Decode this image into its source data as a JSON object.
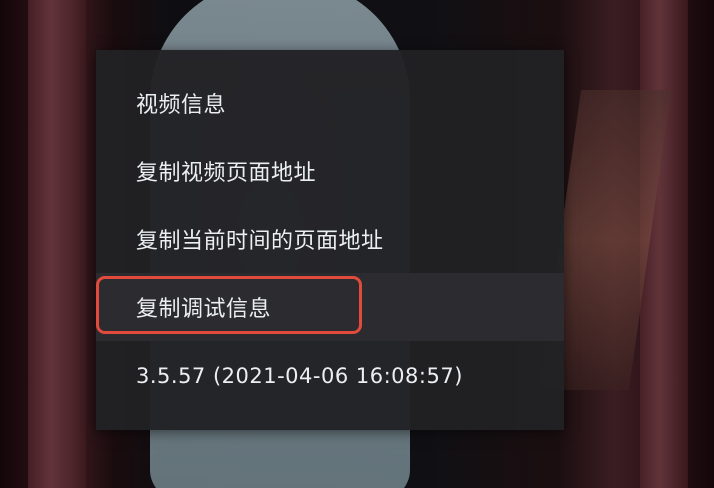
{
  "menu": {
    "items": [
      {
        "label": "视频信息"
      },
      {
        "label": "复制视频页面地址"
      },
      {
        "label": "复制当前时间的页面地址"
      },
      {
        "label": "复制调试信息"
      }
    ],
    "version": "3.5.57 (2021-04-06 16:08:57)"
  },
  "highlight": {
    "color": "#e24a3c",
    "target": "复制调试信息"
  }
}
